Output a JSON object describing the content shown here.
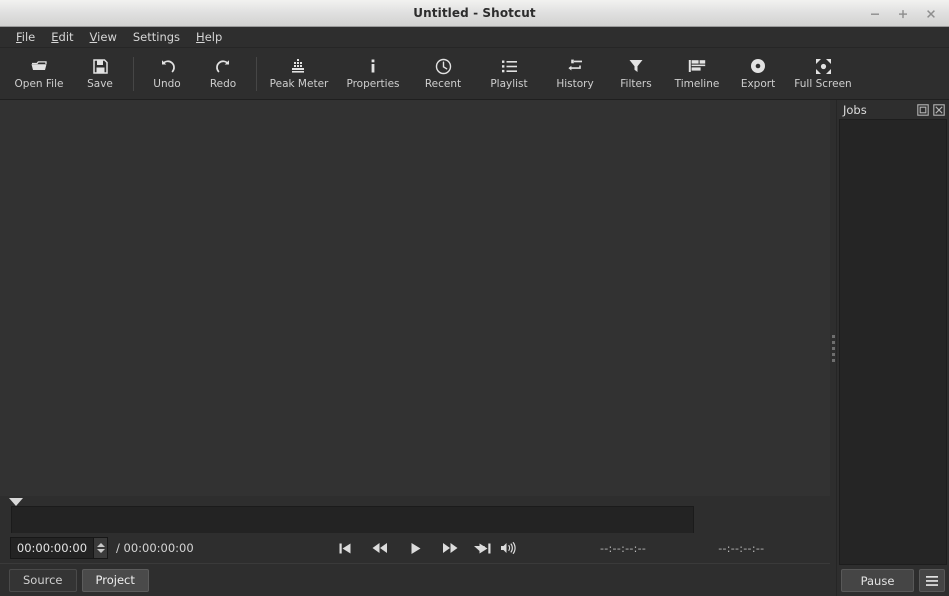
{
  "window": {
    "title": "Untitled - Shotcut",
    "controls": [
      {
        "name": "minimize-button",
        "glyph": "minimize"
      },
      {
        "name": "maximize-button",
        "glyph": "maximize"
      },
      {
        "name": "close-button",
        "glyph": "close"
      }
    ]
  },
  "menubar": {
    "items": [
      {
        "label": "File",
        "mnemonic": "F"
      },
      {
        "label": "Edit",
        "mnemonic": "E"
      },
      {
        "label": "View",
        "mnemonic": "V"
      },
      {
        "label": "Settings",
        "mnemonic": ""
      },
      {
        "label": "Help",
        "mnemonic": "H"
      }
    ]
  },
  "toolbar": {
    "buttons": [
      {
        "label": "Open File",
        "icon": "folder-open-icon"
      },
      {
        "label": "Save",
        "icon": "save-disk-icon"
      },
      {
        "label": "Undo",
        "icon": "undo-arrow-icon"
      },
      {
        "label": "Redo",
        "icon": "redo-arrow-icon"
      },
      {
        "label": "Peak Meter",
        "icon": "peak-meter-icon"
      },
      {
        "label": "Properties",
        "icon": "info-icon"
      },
      {
        "label": "Recent",
        "icon": "clock-icon"
      },
      {
        "label": "Playlist",
        "icon": "list-icon"
      },
      {
        "label": "History",
        "icon": "history-icon"
      },
      {
        "label": "Filters",
        "icon": "funnel-icon"
      },
      {
        "label": "Timeline",
        "icon": "timeline-tracks-icon"
      },
      {
        "label": "Export",
        "icon": "record-disc-icon"
      },
      {
        "label": "Full Screen",
        "icon": "fullscreen-expand-icon"
      }
    ]
  },
  "player": {
    "current_timecode": "00:00:00:00",
    "total_timecode": "/ 00:00:00:00",
    "in_point": "--:--:--:--",
    "out_point": "--:--:--:--",
    "transport": [
      {
        "name": "skip-previous-button",
        "icon": "skip-previous-icon"
      },
      {
        "name": "rewind-button",
        "icon": "rewind-icon"
      },
      {
        "name": "play-button",
        "icon": "play-icon"
      },
      {
        "name": "fast-forward-button",
        "icon": "fast-forward-icon"
      },
      {
        "name": "skip-next-button",
        "icon": "skip-next-icon"
      }
    ],
    "options_icon": "chevron-down-icon",
    "volume_icon": "volume-speaker-icon",
    "tabs": [
      {
        "label": "Source",
        "active": false
      },
      {
        "label": "Project",
        "active": true
      }
    ]
  },
  "jobs": {
    "title": "Jobs",
    "header_icons": [
      {
        "name": "float-panel-icon",
        "glyph": "float"
      },
      {
        "name": "close-panel-icon",
        "glyph": "close"
      }
    ],
    "pause_label": "Pause",
    "menu_icon": "hamburger-menu-icon"
  },
  "colors": {
    "titlebar": "#dedede",
    "chrome": "#2e2e2e",
    "video_background": "#323232",
    "panel_well": "#252525",
    "text": "#d6d6d6"
  }
}
